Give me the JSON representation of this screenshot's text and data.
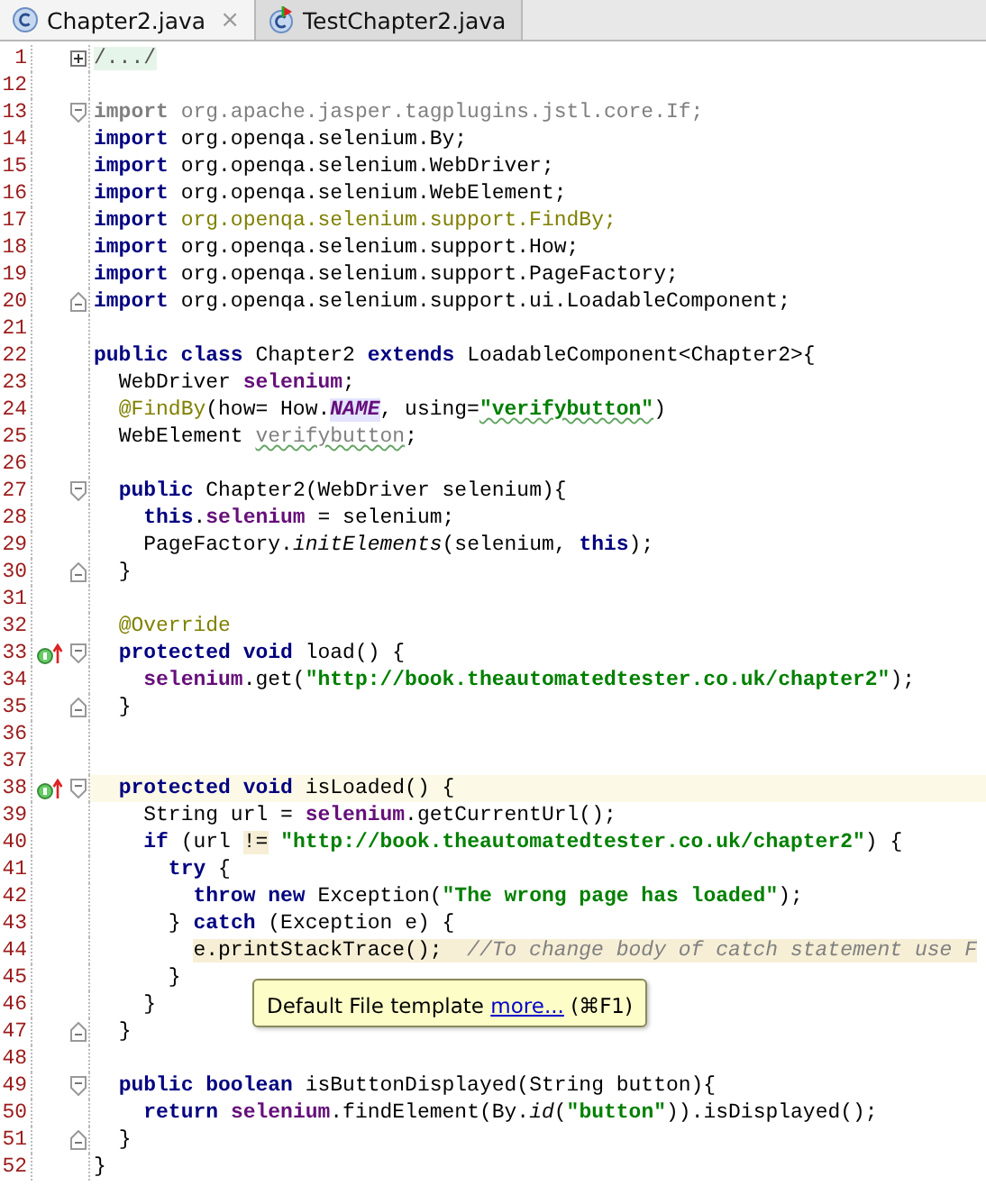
{
  "tabs": [
    {
      "label": "Chapter2.java",
      "selected": true,
      "kind": "class",
      "close": "×"
    },
    {
      "label": "TestChapter2.java",
      "selected": false,
      "kind": "test"
    }
  ],
  "editor": {
    "lines": [
      {
        "number": "1",
        "current": false,
        "fold": {
          "kind": "collapsed"
        },
        "tokens": [
          {
            "text": "/.../",
            "kind": "folded"
          }
        ]
      },
      {
        "number": "12",
        "current": false
      },
      {
        "number": "13",
        "current": false,
        "fold": {
          "kind": "start"
        },
        "tokens": [
          {
            "text": "import",
            "kind": "unused-keyword"
          },
          {
            "text": " org.apache.jasper.tagplugins.jstl.core.If;",
            "kind": "unused"
          }
        ]
      },
      {
        "number": "14",
        "current": false,
        "tokens": [
          {
            "text": "import",
            "kind": "keyword"
          },
          {
            "text": " org.openqa.selenium.By;",
            "kind": "plain"
          }
        ]
      },
      {
        "number": "15",
        "current": false,
        "tokens": [
          {
            "text": "import",
            "kind": "keyword"
          },
          {
            "text": " org.openqa.selenium.WebDriver;",
            "kind": "plain"
          }
        ]
      },
      {
        "number": "16",
        "current": false,
        "tokens": [
          {
            "text": "import",
            "kind": "keyword"
          },
          {
            "text": " org.openqa.selenium.WebElement;",
            "kind": "plain"
          }
        ]
      },
      {
        "number": "17",
        "current": false,
        "tokens": [
          {
            "text": "import",
            "kind": "keyword"
          },
          {
            "text": " org.openqa.selenium.support.FindBy;",
            "kind": "annotation"
          }
        ]
      },
      {
        "number": "18",
        "current": false,
        "tokens": [
          {
            "text": "import",
            "kind": "keyword"
          },
          {
            "text": " org.openqa.selenium.support.How;",
            "kind": "plain"
          }
        ]
      },
      {
        "number": "19",
        "current": false,
        "tokens": [
          {
            "text": "import",
            "kind": "keyword"
          },
          {
            "text": " org.openqa.selenium.support.PageFactory;",
            "kind": "plain"
          }
        ]
      },
      {
        "number": "20",
        "current": false,
        "fold": {
          "kind": "end"
        },
        "tokens": [
          {
            "text": "import",
            "kind": "keyword"
          },
          {
            "text": " org.openqa.selenium.support.ui.LoadableComponent;",
            "kind": "plain"
          }
        ]
      },
      {
        "number": "21",
        "current": false
      },
      {
        "number": "22",
        "current": false,
        "tokens": [
          {
            "text": "public class",
            "kind": "keyword"
          },
          {
            "text": " Chapter2 ",
            "kind": "plain"
          },
          {
            "text": "extends",
            "kind": "keyword"
          },
          {
            "text": " LoadableComponent<Chapter2>{",
            "kind": "plain"
          }
        ]
      },
      {
        "number": "23",
        "current": false,
        "tokens": [
          {
            "text": "  WebDriver ",
            "kind": "plain"
          },
          {
            "text": "selenium",
            "kind": "field"
          },
          {
            "text": ";",
            "kind": "plain"
          }
        ]
      },
      {
        "number": "24",
        "current": false,
        "tokens": [
          {
            "text": "  @FindBy",
            "kind": "annotation"
          },
          {
            "text": "(how= How.",
            "kind": "plain"
          },
          {
            "text": "NAME",
            "kind": "constant"
          },
          {
            "text": ", using=",
            "kind": "plain"
          },
          {
            "text": "\"verifybutton\"",
            "kind": "string",
            "warning": true
          },
          {
            "text": ")",
            "kind": "plain"
          }
        ]
      },
      {
        "number": "25",
        "current": false,
        "tokens": [
          {
            "text": "  WebElement ",
            "kind": "plain"
          },
          {
            "text": "verifybutton",
            "kind": "unused",
            "warning": true
          },
          {
            "text": ";",
            "kind": "plain"
          }
        ]
      },
      {
        "number": "26",
        "current": false
      },
      {
        "number": "27",
        "current": false,
        "fold": {
          "kind": "start"
        },
        "tokens": [
          {
            "text": "  public",
            "kind": "keyword"
          },
          {
            "text": " Chapter2(WebDriver selenium){",
            "kind": "plain"
          }
        ]
      },
      {
        "number": "28",
        "current": false,
        "tokens": [
          {
            "text": "    this",
            "kind": "keyword"
          },
          {
            "text": ".",
            "kind": "plain"
          },
          {
            "text": "selenium",
            "kind": "field"
          },
          {
            "text": " = selenium;",
            "kind": "plain"
          }
        ]
      },
      {
        "number": "29",
        "current": false,
        "tokens": [
          {
            "text": "    PageFactory.",
            "kind": "plain"
          },
          {
            "text": "initElements",
            "kind": "italic"
          },
          {
            "text": "(selenium, ",
            "kind": "plain"
          },
          {
            "text": "this",
            "kind": "keyword"
          },
          {
            "text": ");",
            "kind": "plain"
          }
        ]
      },
      {
        "number": "30",
        "current": false,
        "fold": {
          "kind": "end"
        },
        "tokens": [
          {
            "text": "  }",
            "kind": "plain"
          }
        ]
      },
      {
        "number": "31",
        "current": false
      },
      {
        "number": "32",
        "current": false,
        "tokens": [
          {
            "text": "  @Override",
            "kind": "annotation"
          }
        ]
      },
      {
        "number": "33",
        "current": false,
        "fold": {
          "kind": "start"
        },
        "gutter_icon": {
          "kind": "override"
        },
        "tokens": [
          {
            "text": "  protected void",
            "kind": "keyword"
          },
          {
            "text": " load() {",
            "kind": "plain"
          }
        ]
      },
      {
        "number": "34",
        "current": false,
        "tokens": [
          {
            "text": "    selenium",
            "kind": "field"
          },
          {
            "text": ".get(",
            "kind": "plain"
          },
          {
            "text": "\"http://book.theautomatedtester.co.uk/chapter2\"",
            "kind": "string"
          },
          {
            "text": ");",
            "kind": "plain"
          }
        ]
      },
      {
        "number": "35",
        "current": false,
        "fold": {
          "kind": "end"
        },
        "tokens": [
          {
            "text": "  }",
            "kind": "plain"
          }
        ]
      },
      {
        "number": "36",
        "current": false
      },
      {
        "number": "37",
        "current": false
      },
      {
        "number": "38",
        "current": true,
        "fold": {
          "kind": "start"
        },
        "gutter_icon": {
          "kind": "override"
        },
        "tokens": [
          {
            "text": "  protected void",
            "kind": "keyword"
          },
          {
            "text": " isLoaded() {",
            "kind": "plain"
          }
        ]
      },
      {
        "number": "39",
        "current": false,
        "tokens": [
          {
            "text": "    String url = ",
            "kind": "plain"
          },
          {
            "text": "selenium",
            "kind": "field"
          },
          {
            "text": ".getCurrentUrl();",
            "kind": "plain"
          }
        ]
      },
      {
        "number": "40",
        "current": false,
        "tokens": [
          {
            "text": "    if",
            "kind": "keyword"
          },
          {
            "text": " (url",
            "kind": "plain"
          },
          {
            "text": " !=",
            "kind": "plain",
            "marked": true
          },
          {
            "text": " \"http://book.theautomatedtester.co.uk/chapter2\"",
            "kind": "string"
          },
          {
            "text": ") {",
            "kind": "plain"
          }
        ]
      },
      {
        "number": "41",
        "current": false,
        "tokens": [
          {
            "text": "      try",
            "kind": "keyword"
          },
          {
            "text": " {",
            "kind": "plain"
          }
        ]
      },
      {
        "number": "42",
        "current": false,
        "tokens": [
          {
            "text": "        throw new",
            "kind": "keyword"
          },
          {
            "text": " Exception(",
            "kind": "plain"
          },
          {
            "text": "\"The wrong page has loaded\"",
            "kind": "string"
          },
          {
            "text": ");",
            "kind": "plain"
          }
        ]
      },
      {
        "number": "43",
        "current": false,
        "tokens": [
          {
            "text": "      } ",
            "kind": "plain"
          },
          {
            "text": "catch",
            "kind": "keyword"
          },
          {
            "text": " (Exception e) {",
            "kind": "plain"
          }
        ]
      },
      {
        "number": "44",
        "current": false,
        "tokens": [
          {
            "text": "        e.printStackTrace();  //To change body of catch statement use F",
            "kind": "statement-with-comment",
            "marked": true
          }
        ]
      },
      {
        "number": "45",
        "current": false,
        "tokens": [
          {
            "text": "      }",
            "kind": "plain"
          }
        ]
      },
      {
        "number": "46",
        "current": false,
        "tokens": [
          {
            "text": "    }",
            "kind": "plain"
          }
        ]
      },
      {
        "number": "47",
        "current": false,
        "fold": {
          "kind": "end"
        },
        "tokens": [
          {
            "text": "  }",
            "kind": "plain"
          }
        ]
      },
      {
        "number": "48",
        "current": false
      },
      {
        "number": "49",
        "current": false,
        "fold": {
          "kind": "start"
        },
        "tokens": [
          {
            "text": "  public boolean",
            "kind": "keyword"
          },
          {
            "text": " isButtonDisplayed(String button){",
            "kind": "plain"
          }
        ]
      },
      {
        "number": "50",
        "current": false,
        "tokens": [
          {
            "text": "    return",
            "kind": "keyword"
          },
          {
            "text": " selenium",
            "kind": "field"
          },
          {
            "text": ".findElement(By.",
            "kind": "plain"
          },
          {
            "text": "id",
            "kind": "italic"
          },
          {
            "text": "(",
            "kind": "plain"
          },
          {
            "text": "\"button\"",
            "kind": "string"
          },
          {
            "text": ")).isDisplayed();",
            "kind": "plain"
          }
        ]
      },
      {
        "number": "51",
        "current": false,
        "fold": {
          "kind": "end"
        },
        "tokens": [
          {
            "text": "  }",
            "kind": "plain"
          }
        ]
      },
      {
        "number": "52",
        "current": false,
        "tokens": [
          {
            "text": "}",
            "kind": "plain"
          }
        ]
      }
    ]
  },
  "tooltip": {
    "text": "Default File template ",
    "link": "more...",
    "shortcut": " (⌘F1)"
  }
}
